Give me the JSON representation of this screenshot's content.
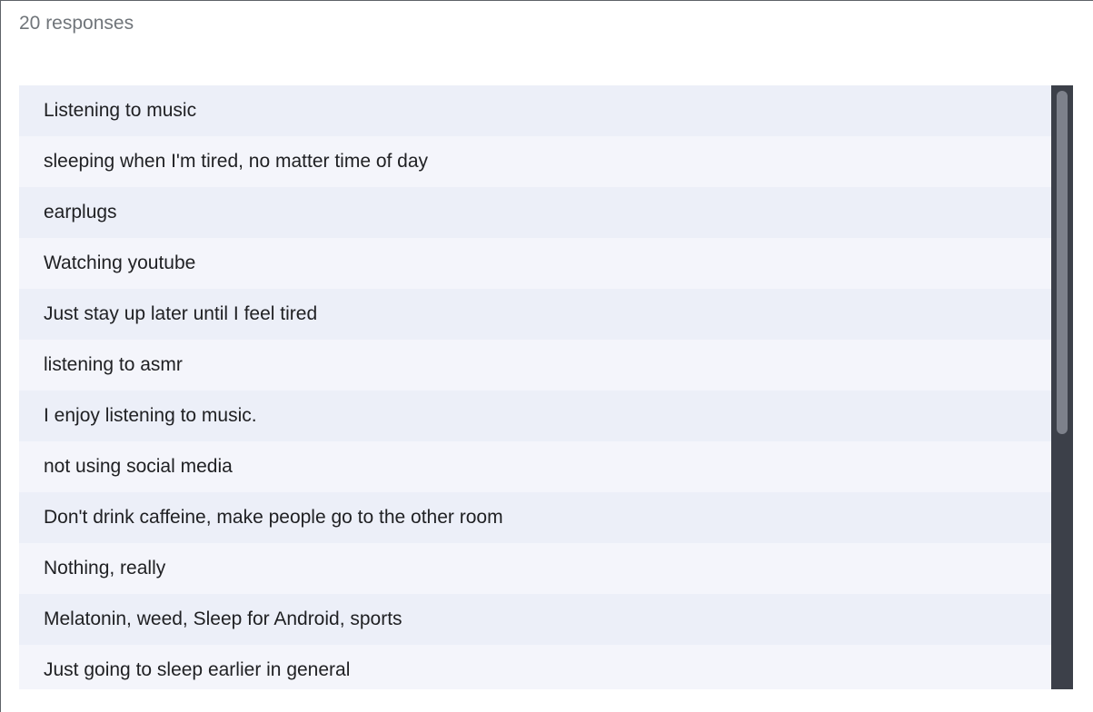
{
  "summary": {
    "responses_label": "20 responses"
  },
  "responses": [
    "Listening to music",
    "sleeping when I'm tired, no matter time of day",
    "earplugs",
    "Watching youtube",
    "Just stay up later until I feel tired",
    "listening to asmr",
    "I enjoy listening to music.",
    "not using social media",
    "Don't drink caffeine, make people go to the other room",
    "Nothing, really",
    "Melatonin, weed, Sleep for Android, sports",
    "Just going to sleep earlier in general"
  ],
  "colors": {
    "row_odd": "#eceff8",
    "row_even": "#f4f5fb",
    "scrollbar_track": "#3c4049",
    "scrollbar_thumb": "#7d818b",
    "count_text": "#70757a"
  }
}
